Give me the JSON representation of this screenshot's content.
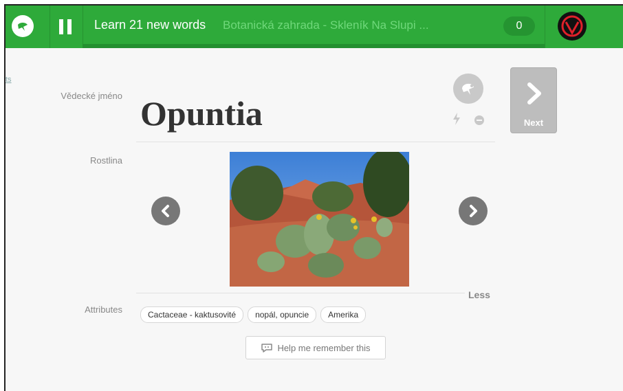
{
  "topbar": {
    "title": "Learn 21 new words",
    "course": "Botanická zahrada - Skleník Na Slupi ...",
    "score": "0",
    "accent": "#2eaa3a"
  },
  "sidebar": {
    "link_text": "ts"
  },
  "card": {
    "labels": {
      "scientific": "Vědecké jméno",
      "plant": "Rostlina",
      "attributes": "Attributes"
    },
    "word": "Opuntia",
    "next_label": "Next",
    "less_label": "Less",
    "tags": [
      "Cactaceae - kaktusovité",
      "nopál, opuncie",
      "Amerika"
    ],
    "help_label": "Help me remember this"
  },
  "icons": {
    "logo": "memrise-logo-icon",
    "pause": "pause-icon",
    "memory": "brain-bulb-icon",
    "bolt": "lightning-icon",
    "ignore": "minus-circle-icon",
    "next": "chevron-right-icon",
    "prev_image": "chevron-left-circle-icon",
    "next_image": "chevron-right-circle-icon",
    "help": "speech-bubble-icon"
  }
}
